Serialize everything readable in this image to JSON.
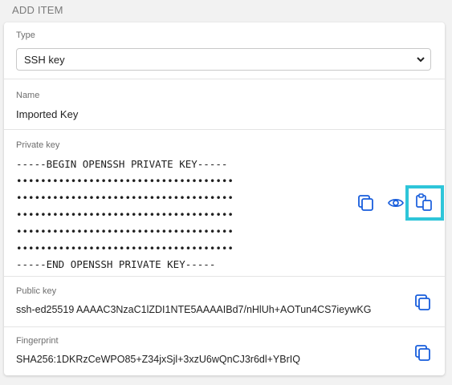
{
  "section": {
    "title": "ADD ITEM"
  },
  "type": {
    "label": "Type",
    "selected": "SSH key"
  },
  "name": {
    "label": "Name",
    "value": "Imported Key"
  },
  "private_key": {
    "label": "Private key",
    "lines": [
      "-----BEGIN OPENSSH PRIVATE KEY-----",
      "••••••••••••••••••••••••••••••••••••",
      "••••••••••••••••••••••••••••••••••••",
      "••••••••••••••••••••••••••••••••••••",
      "••••••••••••••••••••••••••••••••••••",
      "••••••••••••••••••••••••••••••••••••",
      "-----END OPENSSH PRIVATE KEY-----"
    ],
    "actions": [
      "copy-icon",
      "eye-icon",
      "import-clipboard-icon"
    ]
  },
  "public_key": {
    "label": "Public key",
    "value": "ssh-ed25519 AAAAC3NzaC1lZDI1NTE5AAAAIBd7/nHlUh+AOTun4CS7ieywKG"
  },
  "fingerprint": {
    "label": "Fingerprint",
    "value": "SHA256:1DKRzCeWPO85+Z34jxSjl+3xzU6wQnCJ3r6dl+YBrIQ"
  },
  "colors": {
    "accent": "#175ddc",
    "focus": "#2ec5d9"
  }
}
